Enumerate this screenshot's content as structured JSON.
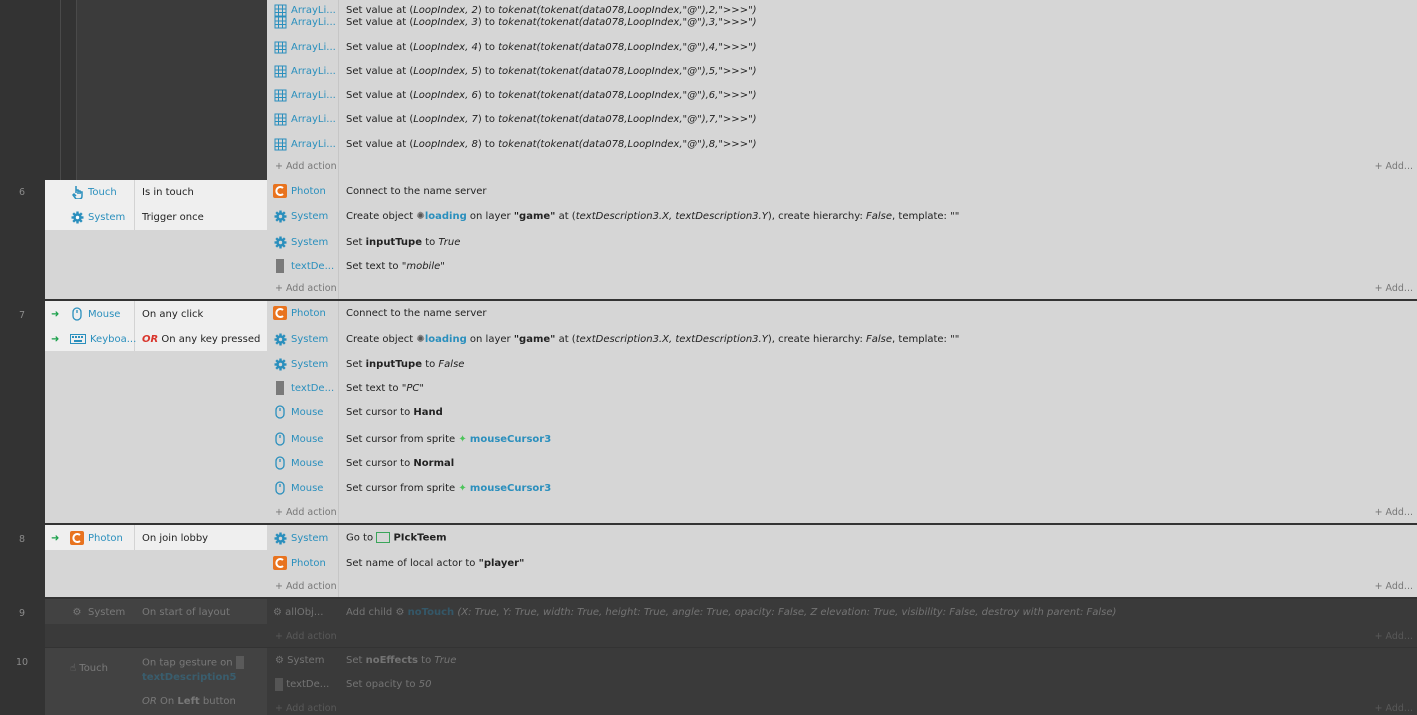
{
  "colors": {
    "background": "#333333",
    "block": "#d6d6d6",
    "object_link": "#2a8fbd",
    "or_keyword": "#d9352c",
    "trigger_arrow": "#1aa04a"
  },
  "top_block": {
    "rows": [
      {
        "object": "ArrayLi...",
        "prefix": "Set value at (",
        "italic": "LoopIndex, 2",
        "mid": ") to ",
        "expr": "tokenat(tokenat(data078,LoopIndex,\"@\"),2,\">>>\")"
      },
      {
        "object": "ArrayLi...",
        "prefix": "Set value at (",
        "italic": "LoopIndex, 3",
        "mid": ") to ",
        "expr": "tokenat(tokenat(data078,LoopIndex,\"@\"),3,\">>>\")"
      },
      {
        "object": "ArrayLi...",
        "prefix": "Set value at (",
        "italic": "LoopIndex, 4",
        "mid": ") to ",
        "expr": "tokenat(tokenat(data078,LoopIndex,\"@\"),4,\">>>\")"
      },
      {
        "object": "ArrayLi...",
        "prefix": "Set value at (",
        "italic": "LoopIndex, 5",
        "mid": ") to ",
        "expr": "tokenat(tokenat(data078,LoopIndex,\"@\"),5,\">>>\")"
      },
      {
        "object": "ArrayLi...",
        "prefix": "Set value at (",
        "italic": "LoopIndex, 6",
        "mid": ") to ",
        "expr": "tokenat(tokenat(data078,LoopIndex,\"@\"),6,\">>>\")"
      },
      {
        "object": "ArrayLi...",
        "prefix": "Set value at (",
        "italic": "LoopIndex, 7",
        "mid": ") to ",
        "expr": "tokenat(tokenat(data078,LoopIndex,\"@\"),7,\">>>\")"
      },
      {
        "object": "ArrayLi...",
        "prefix": "Set value at (",
        "italic": "LoopIndex, 8",
        "mid": ") to ",
        "expr": "tokenat(tokenat(data078,LoopIndex,\"@\"),8,\">>>\")"
      }
    ],
    "add_action": "+ Add action",
    "add_more": "+ Add..."
  },
  "events": {
    "e6": {
      "number": "6",
      "conditions": [
        {
          "object": "Touch",
          "text": "Is in touch"
        },
        {
          "object": "System",
          "text": "Trigger once"
        }
      ],
      "a1_obj": "Photon",
      "a1_text": "Connect to the name server",
      "a2_obj": "System",
      "a2_pre": "Create object",
      "a2_sprite": "loading",
      "a2_mid": "on layer",
      "a2_layer": "\"game\"",
      "a2_at": "at (",
      "a2_coords": "textDescription3.X, textDescription3.Y",
      "a2_tail": "), create hierarchy:",
      "a2_false": "False",
      "a2_tpl": ", template: \"\"",
      "a3_obj": "System",
      "a3_pre": "Set",
      "a3_var": "inputTupe",
      "a3_to": "to",
      "a3_val": "True",
      "a4_obj": "textDe...",
      "a4_pre": "Set text to",
      "a4_val": "\"mobile\"",
      "add_action": "+ Add action",
      "add_more": "+ Add..."
    },
    "e7": {
      "number": "7",
      "c1_obj": "Mouse",
      "c1_text": "On any click",
      "c2_obj": "Keyboa...",
      "c2_or": "OR",
      "c2_text": "On any key pressed",
      "a1_obj": "Photon",
      "a1_text": "Connect to the name server",
      "a2_obj": "System",
      "a2_pre": "Create object",
      "a2_sprite": "loading",
      "a2_mid": "on layer",
      "a2_layer": "\"game\"",
      "a2_at": "at (",
      "a2_coords": "textDescription3.X, textDescription3.Y",
      "a2_tail": "), create hierarchy:",
      "a2_false": "False",
      "a2_tpl": ", template: \"\"",
      "a3_obj": "System",
      "a3_pre": "Set",
      "a3_var": "inputTupe",
      "a3_to": "to",
      "a3_val": "False",
      "a4_obj": "textDe...",
      "a4_pre": "Set text to",
      "a4_val": "\"PC\"",
      "a5_obj": "Mouse",
      "a5_pre": "Set cursor to",
      "a5_val": "Hand",
      "a6_obj": "Mouse",
      "a6_pre": "Set cursor from sprite",
      "a6_val": "mouseCursor3",
      "a7_obj": "Mouse",
      "a7_pre": "Set cursor to",
      "a7_val": "Normal",
      "a8_obj": "Mouse",
      "a8_pre": "Set cursor from sprite",
      "a8_val": "mouseCursor3",
      "add_action": "+ Add action",
      "add_more": "+ Add..."
    },
    "e8": {
      "number": "8",
      "c1_obj": "Photon",
      "c1_text": "On join lobby",
      "a1_obj": "System",
      "a1_pre": "Go to",
      "a1_val": "PIckTeem",
      "a2_obj": "Photon",
      "a2_pre": "Set name of local actor to",
      "a2_val": "\"player\"",
      "add_action": "+ Add action",
      "add_more": "+ Add..."
    },
    "e9": {
      "number": "9",
      "c1_obj": "System",
      "c1_text": "On start of layout",
      "a1_obj": "allObj...",
      "a1_pre": "Add child",
      "a1_val": "noTouch",
      "a1_tail": "(X: True, Y: True, width: True, height: True, angle: True, opacity: False, Z elevation: True, visibility: False, destroy with parent: False)",
      "add_action": "+ Add action",
      "add_more": "+ Add..."
    },
    "e10": {
      "number": "10",
      "c1_obj": "Touch",
      "c1_text": "On tap gesture on",
      "c1_target": "textDescription5",
      "c2_or": "OR",
      "c2_text": "On",
      "c2_bold": "Left",
      "c2_tail": "button",
      "a1_obj": "System",
      "a1_pre": "Set",
      "a1_var": "noEffects",
      "a1_to": "to",
      "a1_val": "True",
      "a2_obj": "textDe...",
      "a2_pre": "Set opacity to",
      "a2_val": "50",
      "add_action": "+ Add action",
      "add_more": "+ Add..."
    }
  }
}
